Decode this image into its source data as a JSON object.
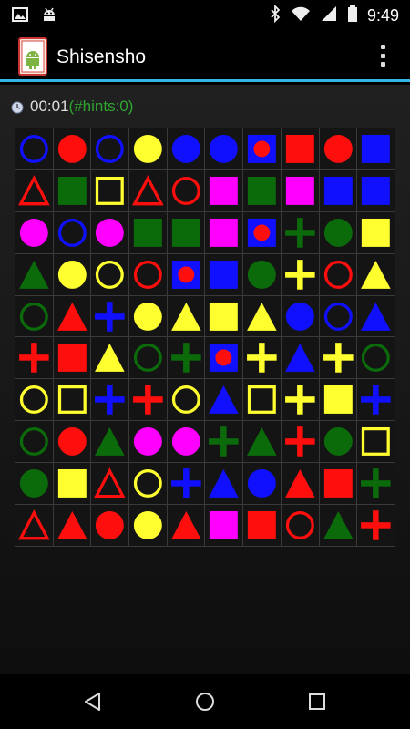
{
  "statusbar": {
    "time": "9:49"
  },
  "app": {
    "title": "Shisensho"
  },
  "timer": {
    "time": "00:01",
    "hints": "(#hints:0)"
  },
  "colors": {
    "B": "#1010ff",
    "R": "#ff0e0e",
    "Y": "#ffff30",
    "G": "#0b6b0b",
    "M": "#ff00ff",
    "accent": "#33b5e5",
    "hint_green": "#2fa52f"
  },
  "board": {
    "rows": 10,
    "cols": 10,
    "tiles": [
      [
        "ring-B",
        "circle-R",
        "ring-B",
        "circle-Y",
        "circle-B",
        "circle-B",
        "squaredot-B",
        "square-R",
        "circle-R",
        "square-B"
      ],
      [
        "tri-out-R",
        "square-G",
        "square-out-Y",
        "tri-out-R",
        "ring-R",
        "square-M",
        "square-G",
        "square-M",
        "square-B",
        "square-B"
      ],
      [
        "circle-M",
        "ring-B",
        "circle-M",
        "square-G",
        "square-G",
        "square-M",
        "squaredot-B",
        "cross-G",
        "circle-G",
        "square-Y"
      ],
      [
        "tri-G",
        "circle-Y",
        "ring-Y",
        "ring-R",
        "squaredot-B",
        "square-B",
        "circle-G",
        "cross-Y",
        "ring-R",
        "tri-Y"
      ],
      [
        "ring-G",
        "tri-R",
        "cross-B",
        "circle-Y",
        "tri-Y",
        "square-Y",
        "tri-Y",
        "circle-B",
        "ring-B",
        "tri-B"
      ],
      [
        "cross-R",
        "square-R",
        "tri-Y",
        "ring-G",
        "cross-G",
        "squaredot-B",
        "cross-Y",
        "tri-B",
        "cross-Y",
        "ring-G"
      ],
      [
        "ring-Y",
        "square-out-Y",
        "cross-B",
        "cross-R",
        "ring-Y",
        "tri-B",
        "square-out-Y",
        "cross-Y",
        "square-Y",
        "cross-B"
      ],
      [
        "ring-G",
        "circle-R",
        "tri-G",
        "circle-M",
        "circle-M",
        "cross-G",
        "tri-G",
        "cross-R",
        "circle-G",
        "square-out-Y"
      ],
      [
        "circle-G",
        "square-Y",
        "tri-out-R",
        "ring-Y",
        "cross-B",
        "tri-B",
        "circle-B",
        "tri-R",
        "square-R",
        "cross-G"
      ],
      [
        "tri-out-R",
        "tri-R",
        "circle-R",
        "circle-Y",
        "tri-R",
        "square-M",
        "square-R",
        "ring-R",
        "tri-G",
        "cross-R"
      ]
    ]
  }
}
